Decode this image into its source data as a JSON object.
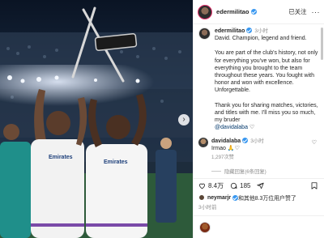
{
  "post": {
    "username": "edermilitao",
    "follow_label": "已关注",
    "more_label": "···"
  },
  "caption": {
    "username": "edermilitao",
    "time": "3小时",
    "line1": "David. Champion, legend and friend.",
    "para2": "You are part of the club's history, not only for everything you've won, but also for everything you brought to the team throughout these years. You fought with honor and won with excellence. Unforgettable.",
    "para3_text": "Thank you for sharing matches, victories, and titles with me. I'll miss you so much, my bruder",
    "mention": "@davidalaba"
  },
  "reply": {
    "username": "davidalaba",
    "text": "Irmao",
    "time": "3小时",
    "likes": "1,297次赞",
    "hide_label": "隐藏回复(6条回复)"
  },
  "actions": {
    "like_count": "8.4万",
    "comment_count": "185"
  },
  "liked_by": {
    "user": "neymarjr",
    "rest": "和其他8.3万位用户赞了"
  },
  "post_time": "3小时前",
  "colors": {
    "verified": "#3897f0",
    "link": "#00376b",
    "muted": "#8e8e8e"
  }
}
